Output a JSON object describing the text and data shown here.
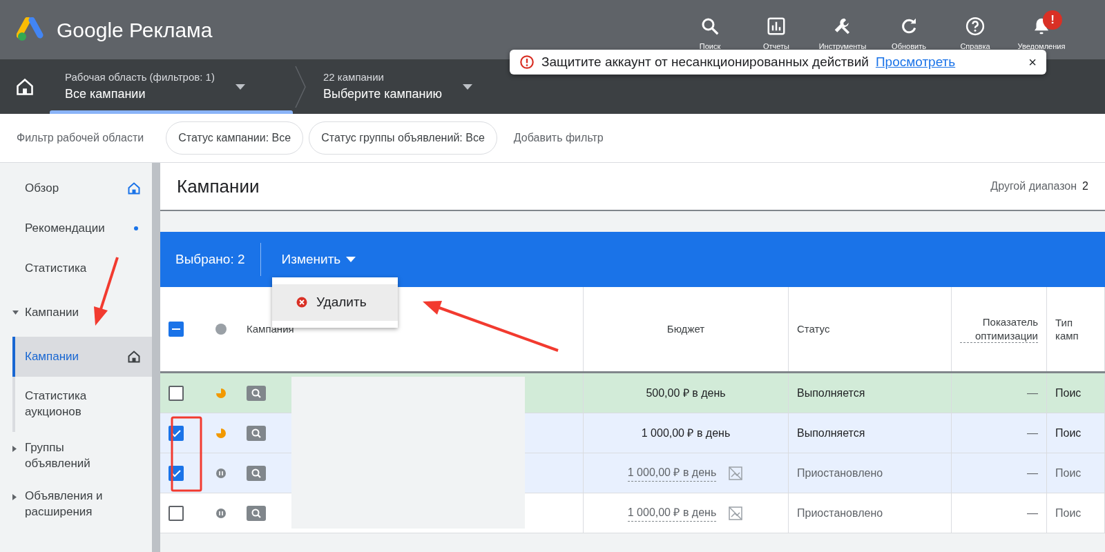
{
  "app": {
    "title": "Google Реклама"
  },
  "toolbar": [
    {
      "label": "Поиск",
      "kind": "search"
    },
    {
      "label": "Отчеты",
      "kind": "reports"
    },
    {
      "label": "Инструменты",
      "kind": "tools"
    },
    {
      "label": "Обновить",
      "kind": "refresh"
    },
    {
      "label": "Справка",
      "kind": "help"
    },
    {
      "label": "Уведомления",
      "kind": "notifications",
      "badge": "!"
    }
  ],
  "toast": {
    "text": "Защитите аккаунт от несанкционированных действий",
    "link": "Просмотреть",
    "close": "×"
  },
  "breadcrumbs": [
    {
      "caption": "Рабочая область (фильтров: 1)",
      "value": "Все кампании",
      "selected": true
    },
    {
      "caption": "22 кампании",
      "value": "Выберите кампанию",
      "selected": false
    }
  ],
  "filter_bar": {
    "label": "Фильтр рабочей области",
    "chips": [
      "Статус кампании: Все",
      "Статус группы объявлений: Все"
    ],
    "add": "Добавить фильтр"
  },
  "sidebar": {
    "items": [
      {
        "label": "Обзор",
        "kind": "home",
        "selected": false
      },
      {
        "label": "Рекомендации",
        "kind": "dot",
        "selected": false
      },
      {
        "label": "Статистика",
        "kind": "plain",
        "selected": false
      },
      {
        "label": "Кампании",
        "kind": "group",
        "expanded": true,
        "children": [
          {
            "label": "Кампании",
            "kind": "home",
            "selected": true
          },
          {
            "label": "Статистика аукционов",
            "kind": "plain",
            "selected": false
          }
        ]
      },
      {
        "label": "Группы объявлений",
        "kind": "group",
        "expanded": false
      },
      {
        "label": "Объявления и расширения",
        "kind": "group",
        "expanded": false
      }
    ]
  },
  "page": {
    "title": "Кампании",
    "date_label": "Другой диапазон",
    "date_value": "2"
  },
  "selection_bar": {
    "count": "Выбрано: 2",
    "action": "Изменить",
    "menu": [
      {
        "label": "Удалить",
        "kind": "delete"
      }
    ]
  },
  "table": {
    "select_all_indeterminate": true,
    "columns": [
      "Кампания",
      "Бюджет",
      "Статус",
      "Показатель оптимизации",
      "Тип камп"
    ],
    "rows": [
      {
        "checked": false,
        "highlighted": true,
        "kind": "running",
        "budget": "500,00 ₽ в день",
        "status": "Выполняется",
        "optimization": "—",
        "type": "Поис"
      },
      {
        "checked": true,
        "highlighted": false,
        "kind": "running",
        "budget": "1 000,00 ₽ в день",
        "status": "Выполняется",
        "optimization": "—",
        "type": "Поис"
      },
      {
        "checked": true,
        "highlighted": false,
        "kind": "paused",
        "budget": "1 000,00 ₽ в день",
        "status": "Приостановлено",
        "optimization": "—",
        "type": "Поис"
      },
      {
        "checked": false,
        "highlighted": false,
        "kind": "paused",
        "budget": "1 000,00 ₽ в день",
        "status": "Приостановлено",
        "optimization": "—",
        "type": "Поис"
      }
    ]
  }
}
